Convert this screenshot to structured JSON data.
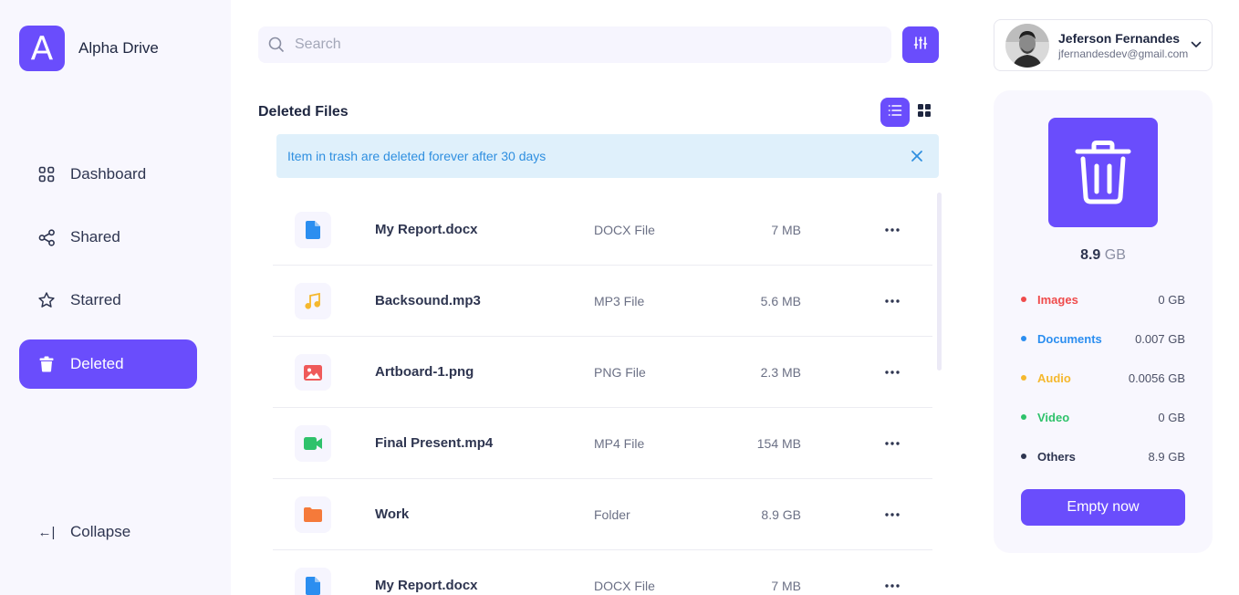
{
  "brand": {
    "logo_letter": "A",
    "name": "Alpha Drive",
    "color": "#6a4dfc"
  },
  "sidebar": {
    "items": [
      {
        "label": "Dashboard",
        "icon": "grid-icon"
      },
      {
        "label": "Shared",
        "icon": "share-icon"
      },
      {
        "label": "Starred",
        "icon": "star-icon"
      },
      {
        "label": "Deleted",
        "icon": "trash-icon",
        "active": true
      }
    ],
    "collapse_label": "Collapse",
    "collapse_glyph": "←|"
  },
  "search": {
    "placeholder": "Search",
    "value": ""
  },
  "main": {
    "title": "Deleted Files",
    "notice": "Item in trash are deleted forever after 30 days",
    "files": [
      {
        "name": "My Report.docx",
        "type": "DOCX File",
        "size": "7 MB",
        "icon": "document-icon",
        "color": "#2b8ef0"
      },
      {
        "name": "Backsound.mp3",
        "type": "MP3 File",
        "size": "5.6 MB",
        "icon": "music-icon",
        "color": "#f5b82e"
      },
      {
        "name": "Artboard-1.png",
        "type": "PNG File",
        "size": "2.3 MB",
        "icon": "image-icon",
        "color": "#ef5a5a"
      },
      {
        "name": "Final Present.mp4",
        "type": "MP4 File",
        "size": "154 MB",
        "icon": "video-icon",
        "color": "#2fc26b"
      },
      {
        "name": "Work",
        "type": "Folder",
        "size": "8.9 GB",
        "icon": "folder-icon",
        "color": "#f57a3a"
      },
      {
        "name": "My Report.docx",
        "type": "DOCX File",
        "size": "7 MB",
        "icon": "document-icon",
        "color": "#2b8ef0"
      }
    ]
  },
  "profile": {
    "name": "Jeferson Fernandes",
    "email": "jfernandesdev@gmail.com"
  },
  "storage": {
    "total_value": "8.9",
    "total_unit": "GB",
    "categories": [
      {
        "label": "Images",
        "value": "0 GB",
        "color": "#ef4b4b"
      },
      {
        "label": "Documents",
        "value": "0.007 GB",
        "color": "#2b8ef0"
      },
      {
        "label": "Audio",
        "value": "0.0056 GB",
        "color": "#f5b82e"
      },
      {
        "label": "Video",
        "value": "0 GB",
        "color": "#2fc26b"
      },
      {
        "label": "Others",
        "value": "8.9 GB",
        "color": "#2e3550"
      }
    ],
    "empty_label": "Empty now"
  }
}
